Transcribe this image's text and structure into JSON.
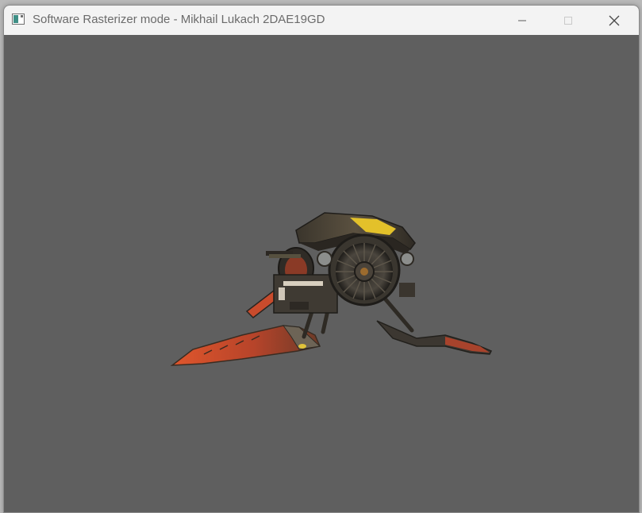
{
  "window": {
    "title": "Software Rasterizer mode - Mikhail Lukach 2DAE19GD"
  },
  "controls": {
    "minimize_icon": "minimize-icon",
    "maximize_icon": "maximize-icon",
    "close_icon": "close-icon"
  },
  "viewport": {
    "background_color": "#5f5f5f",
    "model_icon": "vehicle-3d-model"
  },
  "colors": {
    "titlebar": "#f3f3f3",
    "accent_yellow": "#e3c12a",
    "accent_orange": "#d2502b",
    "metal_dark": "#3a3630"
  }
}
